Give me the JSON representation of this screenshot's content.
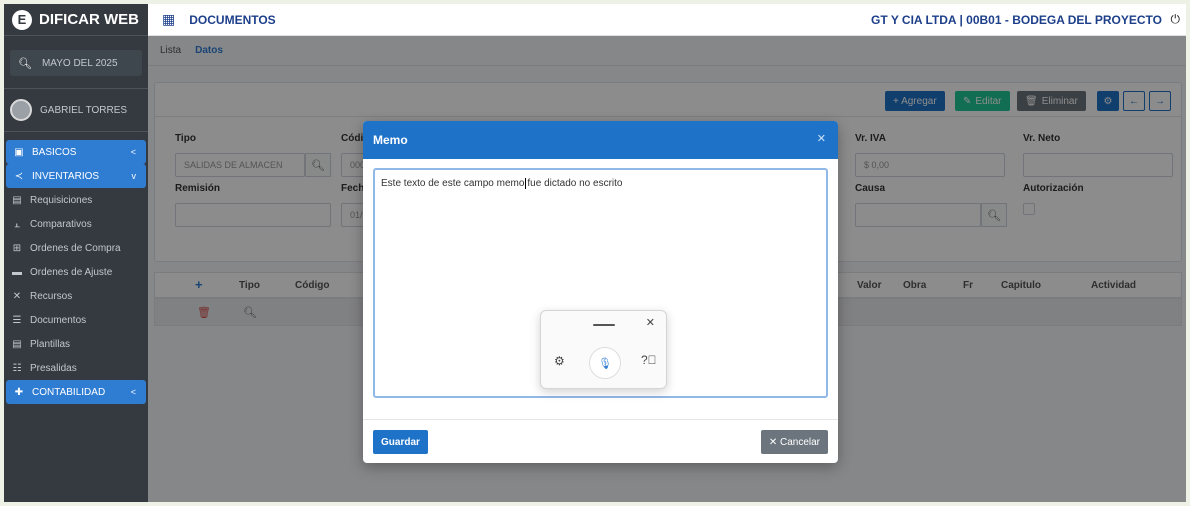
{
  "brand": {
    "name": "DIFICAR WEB",
    "logo_letter": "E"
  },
  "period": {
    "label": "MAYO DEL 2025"
  },
  "user": {
    "name": "GABRIEL TORRES"
  },
  "nav": [
    {
      "label": "BASICOS",
      "chev": "<",
      "active": true
    },
    {
      "label": "INVENTARIOS",
      "chev": "v",
      "active": true
    },
    {
      "label": "Requisiciones"
    },
    {
      "label": "Comparativos"
    },
    {
      "label": "Ordenes de Compra"
    },
    {
      "label": "Ordenes de Ajuste"
    },
    {
      "label": "Recursos"
    },
    {
      "label": "Documentos"
    },
    {
      "label": "Plantillas"
    },
    {
      "label": "Presalidas"
    },
    {
      "label": "CONTABILIDAD",
      "chev": "<",
      "active": true
    }
  ],
  "header": {
    "title": "DOCUMENTOS",
    "company": "GT Y CIA LTDA | 00B01 - BODEGA DEL PROYECTO"
  },
  "tabs": [
    {
      "label": "Lista"
    },
    {
      "label": "Datos"
    }
  ],
  "toolbar": {
    "add": "+ Agregar",
    "edit": "Editar",
    "delete": "Eliminar"
  },
  "form": {
    "tipo_label": "Tipo",
    "tipo_value": "SALIDAS DE ALMACEN",
    "codigo_label": "Códi",
    "codigo_value": "000",
    "remision_label": "Remisión",
    "fecha_label": "Fech",
    "fecha_value": "01/",
    "vr_iva_label": "Vr. IVA",
    "vr_iva_value": "$ 0,00",
    "vr_neto_label": "Vr. Neto",
    "causa_label": "Causa",
    "autorizacion_label": "Autorización"
  },
  "lines": {
    "add_symbol": "+",
    "headers": [
      "Tipo",
      "Código",
      "Valor",
      "Obra",
      "Fr",
      "Capitulo",
      "Actividad"
    ]
  },
  "modal": {
    "title": "Memo",
    "text_before_caret": "Este texto de este campo memo",
    "text_after_caret": "fue dictado no escrito",
    "save": "Guardar",
    "cancel": "✕ Cancelar"
  },
  "colors": {
    "primary": "#1e73c9",
    "success": "#20c997",
    "sidebar": "#343a40"
  }
}
